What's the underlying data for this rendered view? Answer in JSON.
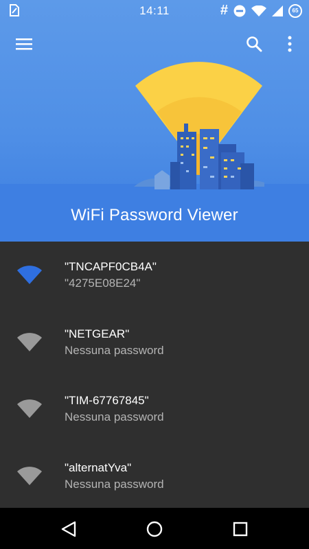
{
  "status_bar": {
    "time": "14:11",
    "left_icon": "sim-card-icon",
    "right_icons": [
      "hash-icon",
      "do-not-disturb-icon",
      "wifi-signal-icon",
      "cell-signal-icon",
      "battery-icon"
    ],
    "battery_level": "65"
  },
  "toolbar": {
    "menu_icon": "hamburger-menu-icon",
    "search_icon": "search-icon",
    "overflow_icon": "more-vert-icon"
  },
  "app": {
    "title": "WiFi Password Viewer"
  },
  "colors": {
    "hero_blue": "#4f8fe6",
    "sun_yellow": "#fbd146",
    "wifi_active": "#2f6fe0",
    "wifi_inactive": "#9a9a9a",
    "list_bg": "#2f2f2f"
  },
  "networks": [
    {
      "ssid": "\"TNCAPF0CB4A\"",
      "password": "\"4275E08E24\"",
      "active": true
    },
    {
      "ssid": "\"NETGEAR\"",
      "password": "Nessuna password",
      "active": false
    },
    {
      "ssid": "\"TIM-67767845\"",
      "password": "Nessuna password",
      "active": false
    },
    {
      "ssid": "\"alternatYva\"",
      "password": "Nessuna password",
      "active": false
    }
  ],
  "nav_bar": {
    "back_icon": "back-triangle-icon",
    "home_icon": "home-circle-icon",
    "recent_icon": "recent-apps-square-icon"
  }
}
